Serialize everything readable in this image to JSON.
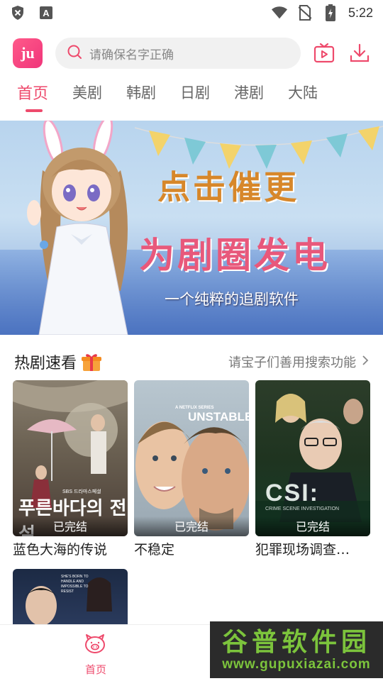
{
  "status_bar": {
    "time": "5:22",
    "icons": [
      "shield-icon",
      "a-letter-icon",
      "wifi-icon",
      "no-sim-icon",
      "battery-charging-icon"
    ]
  },
  "header": {
    "logo_text": "ju",
    "search_placeholder": "请确保名字正确",
    "icons": [
      "tv-play-icon",
      "download-icon"
    ]
  },
  "tabs": [
    {
      "label": "首页",
      "active": true
    },
    {
      "label": "美剧",
      "active": false
    },
    {
      "label": "韩剧",
      "active": false
    },
    {
      "label": "日剧",
      "active": false
    },
    {
      "label": "港剧",
      "active": false
    },
    {
      "label": "大陆",
      "active": false
    }
  ],
  "banner": {
    "line1": "点击催更",
    "line2": "为剧圈发电",
    "line3": "一个纯粹的追剧软件"
  },
  "section": {
    "title": "热剧速看",
    "hint": "请宝子们善用搜索功能"
  },
  "cards": [
    {
      "title": "蓝色大海的传说",
      "badge": "已完结",
      "poster_text": "푸른바다의 전설",
      "poster_small": "SBS 드라마스페셜"
    },
    {
      "title": "不稳定",
      "badge": "已完结",
      "poster_text": "UNSTABLE",
      "poster_small": "A NETFLIX SERIES"
    },
    {
      "title": "犯罪现场调查…",
      "badge": "已完结",
      "poster_text": "CSI:",
      "poster_small": "CRIME SCENE INVESTIGATION"
    },
    {
      "title": "",
      "badge": "",
      "poster_text": "",
      "poster_small": "SHE'S BORN TO HANDLE AND IMPOSSIBLE TO RESIST"
    }
  ],
  "bottom_nav": {
    "home_label": "首页"
  },
  "watermark": {
    "main": "谷普软件园",
    "url": "www.gupuxiazai.com"
  },
  "colors": {
    "accent": "#ee4a6c",
    "logo": "#f0357a"
  }
}
